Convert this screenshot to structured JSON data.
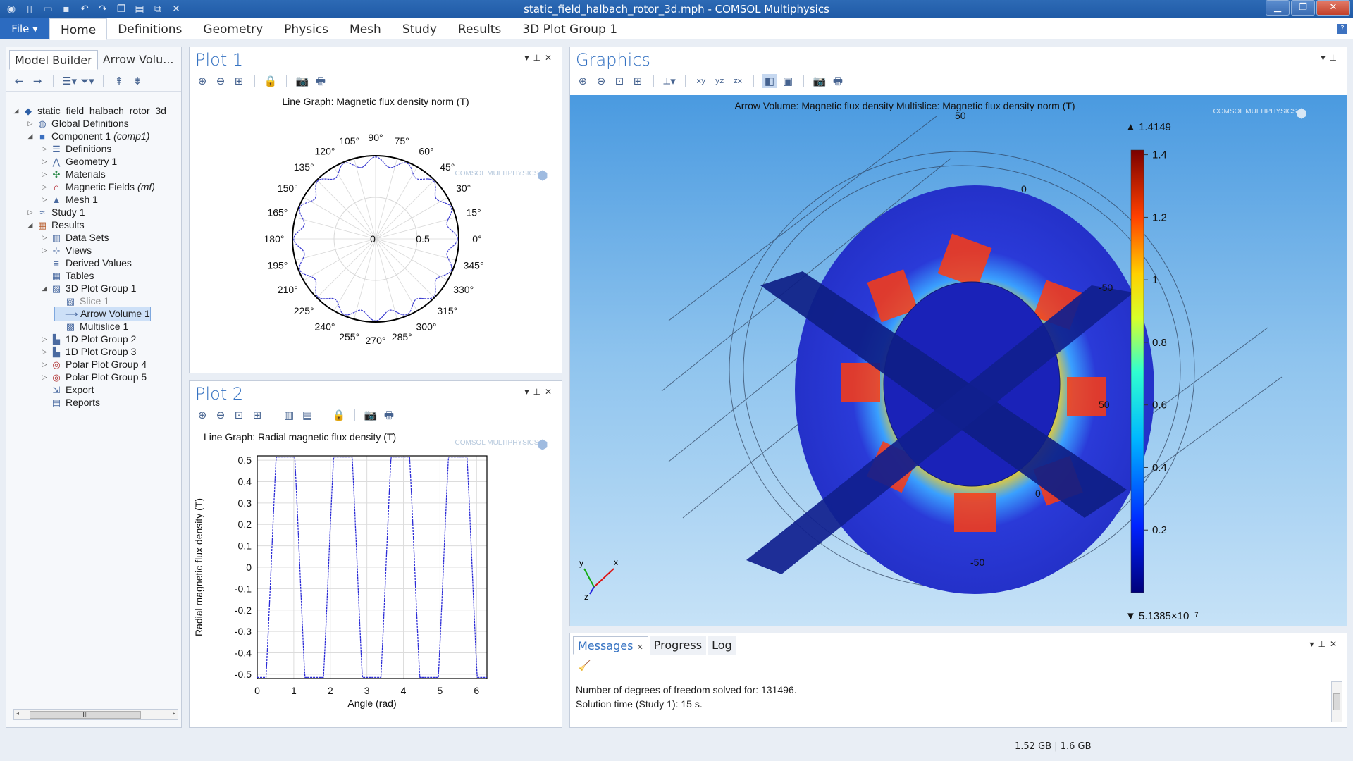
{
  "window": {
    "title": "static_field_halbach_rotor_3d.mph - COMSOL Multiphysics"
  },
  "ribbon": {
    "file": "File",
    "tabs": [
      "Home",
      "Definitions",
      "Geometry",
      "Physics",
      "Mesh",
      "Study",
      "Results",
      "3D Plot Group 1"
    ],
    "help": "?"
  },
  "model_builder": {
    "tabs": [
      "Model Builder",
      "Arrow Volu..."
    ],
    "tree": [
      {
        "label": "static_field_halbach_rotor_3d",
        "level": 0,
        "icon": "model-icon",
        "expand": "open"
      },
      {
        "label": "Global Definitions",
        "level": 1,
        "icon": "global-definitions-icon",
        "expand": "closed"
      },
      {
        "label": "Component 1",
        "tag": "(comp1)",
        "level": 1,
        "icon": "component-icon",
        "expand": "open"
      },
      {
        "label": "Definitions",
        "level": 2,
        "icon": "definitions-icon",
        "expand": "closed"
      },
      {
        "label": "Geometry 1",
        "level": 2,
        "icon": "geometry-icon",
        "expand": "closed"
      },
      {
        "label": "Materials",
        "level": 2,
        "icon": "materials-icon",
        "expand": "closed"
      },
      {
        "label": "Magnetic Fields",
        "tag": "(mf)",
        "level": 2,
        "icon": "magnet-icon",
        "expand": "closed"
      },
      {
        "label": "Mesh 1",
        "level": 2,
        "icon": "mesh-icon",
        "expand": "closed"
      },
      {
        "label": "Study 1",
        "level": 1,
        "icon": "study-icon",
        "expand": "closed"
      },
      {
        "label": "Results",
        "level": 1,
        "icon": "results-icon",
        "expand": "open"
      },
      {
        "label": "Data Sets",
        "level": 2,
        "icon": "datasets-icon",
        "expand": "closed"
      },
      {
        "label": "Views",
        "level": 2,
        "icon": "views-icon",
        "expand": "closed"
      },
      {
        "label": "Derived Values",
        "level": 2,
        "icon": "derived-values-icon",
        "expand": "none"
      },
      {
        "label": "Tables",
        "level": 2,
        "icon": "tables-icon",
        "expand": "none"
      },
      {
        "label": "3D Plot Group 1",
        "level": 2,
        "icon": "plot-group-3d-icon",
        "expand": "open"
      },
      {
        "label": "Slice 1",
        "level": 3,
        "icon": "slice-icon",
        "expand": "none",
        "state": "disabled"
      },
      {
        "label": "Arrow Volume 1",
        "level": 3,
        "icon": "arrow-volume-icon",
        "expand": "none",
        "state": "selected"
      },
      {
        "label": "Multislice 1",
        "level": 3,
        "icon": "multislice-icon",
        "expand": "none"
      },
      {
        "label": "1D Plot Group 2",
        "level": 2,
        "icon": "plot-group-1d-icon",
        "expand": "closed"
      },
      {
        "label": "1D Plot Group 3",
        "level": 2,
        "icon": "plot-group-1d-icon",
        "expand": "closed"
      },
      {
        "label": "Polar Plot Group 4",
        "level": 2,
        "icon": "polar-plot-icon",
        "expand": "closed"
      },
      {
        "label": "Polar Plot Group 5",
        "level": 2,
        "icon": "polar-plot-icon",
        "expand": "closed"
      },
      {
        "label": "Export",
        "level": 2,
        "icon": "export-icon",
        "expand": "none"
      },
      {
        "label": "Reports",
        "level": 2,
        "icon": "reports-icon",
        "expand": "none"
      }
    ],
    "scroll_thumb": "III"
  },
  "plot1": {
    "title": "Plot 1",
    "graph_title": "Line Graph: Magnetic flux density norm (T)",
    "watermark": "COMSOL MULTIPHYSICS",
    "angles": [
      "0°",
      "15°",
      "30°",
      "45°",
      "60°",
      "75°",
      "90°",
      "105°",
      "120°",
      "135°",
      "150°",
      "165°",
      "180°",
      "195°",
      "210°",
      "225°",
      "240°",
      "255°",
      "270°",
      "285°",
      "300°",
      "315°",
      "330°",
      "345°"
    ],
    "radial_labels": [
      "0",
      "0.5"
    ]
  },
  "plot2": {
    "title": "Plot 2",
    "graph_title": "Line Graph: Radial magnetic flux density (T)",
    "watermark": "COMSOL MULTIPHYSICS",
    "chart_data": {
      "type": "line",
      "xlabel": "Angle (rad)",
      "ylabel": "Radial magnetic flux density (T)",
      "xlim": [
        0,
        6.2832
      ],
      "ylim": [
        -0.52,
        0.52
      ],
      "xticks": [
        "0",
        "1",
        "2",
        "3",
        "4",
        "5",
        "6"
      ],
      "yticks": [
        "0.5",
        "0.4",
        "0.3",
        "0.2",
        "0.1",
        "0",
        "-0.1",
        "-0.2",
        "-0.3",
        "-0.4",
        "-0.5"
      ],
      "series": [
        {
          "color": "#2b2bd6",
          "periods": 4,
          "amplitude": 0.52
        }
      ]
    }
  },
  "graphics": {
    "title": "Graphics",
    "plot_title": "Arrow Volume: Magnetic flux density  Multislice: Magnetic flux density norm (T)",
    "watermark": "COMSOL MULTIPHYSICS",
    "colorbar": {
      "max_label": "▲ 1.4149",
      "min_label": "▼ 5.1385×10⁻⁷",
      "ticks": [
        "1.4",
        "1.2",
        "1",
        "0.8",
        "0.6",
        "0.4",
        "0.2"
      ]
    },
    "axis_labels": [
      "50",
      "0",
      "-50",
      "50",
      "0",
      "-50"
    ],
    "triad": {
      "x": "x",
      "y": "y",
      "z": "z"
    }
  },
  "messages": {
    "tabs": [
      "Messages",
      "Progress",
      "Log"
    ],
    "lines": [
      "Number of degrees of freedom solved for: 131496.",
      "Solution time (Study 1): 15 s."
    ]
  },
  "status": {
    "memory": "1.52 GB | 1.6 GB"
  }
}
